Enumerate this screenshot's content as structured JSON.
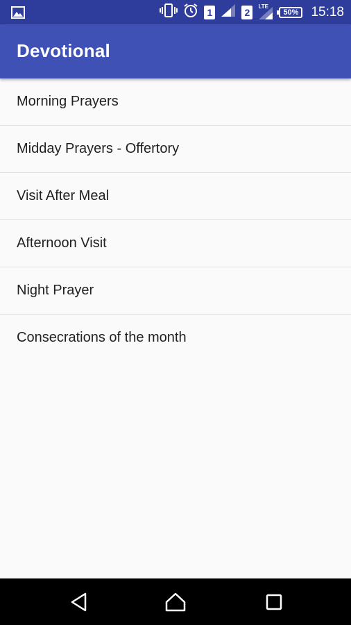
{
  "status_bar": {
    "sim1": "1",
    "sim2": "2",
    "network_type": "LTE",
    "battery": "50%",
    "time": "15:18"
  },
  "app_bar": {
    "title": "Devotional"
  },
  "list": {
    "items": [
      {
        "label": "Morning Prayers"
      },
      {
        "label": "Midday Prayers - Offertory"
      },
      {
        "label": "Visit After Meal"
      },
      {
        "label": "Afternoon Visit"
      },
      {
        "label": "Night Prayer"
      },
      {
        "label": "Consecrations of the month"
      }
    ]
  },
  "nav_bar": {
    "icons": [
      "back-icon",
      "home-icon",
      "recents-icon"
    ]
  },
  "colors": {
    "status_bar": "#2e3d9c",
    "app_bar": "#3f51b5",
    "background": "#fafafa",
    "divider": "#e0e0e0",
    "nav_bar": "#000000"
  }
}
